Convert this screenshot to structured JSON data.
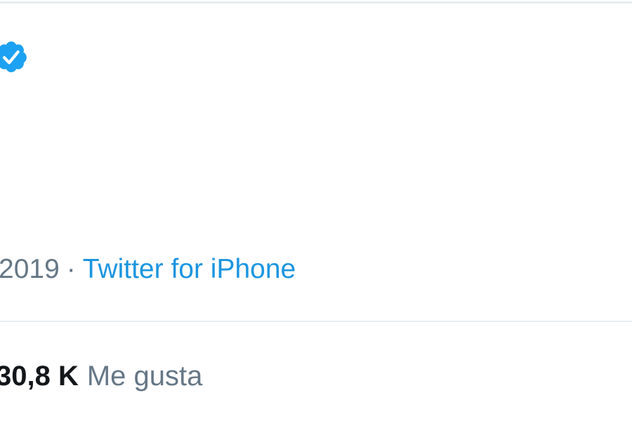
{
  "tweet": {
    "verified_icon": "verified-badge-icon",
    "date": "2019",
    "separator": "·",
    "source": "Twitter for iPhone",
    "likes_count": "30,8 K",
    "likes_label": "Me gusta"
  },
  "colors": {
    "badge": "#1da1f2",
    "link": "#1b95e0",
    "muted_text": "#657786",
    "strong_text": "#14171a",
    "divider": "#e6ecf0"
  }
}
